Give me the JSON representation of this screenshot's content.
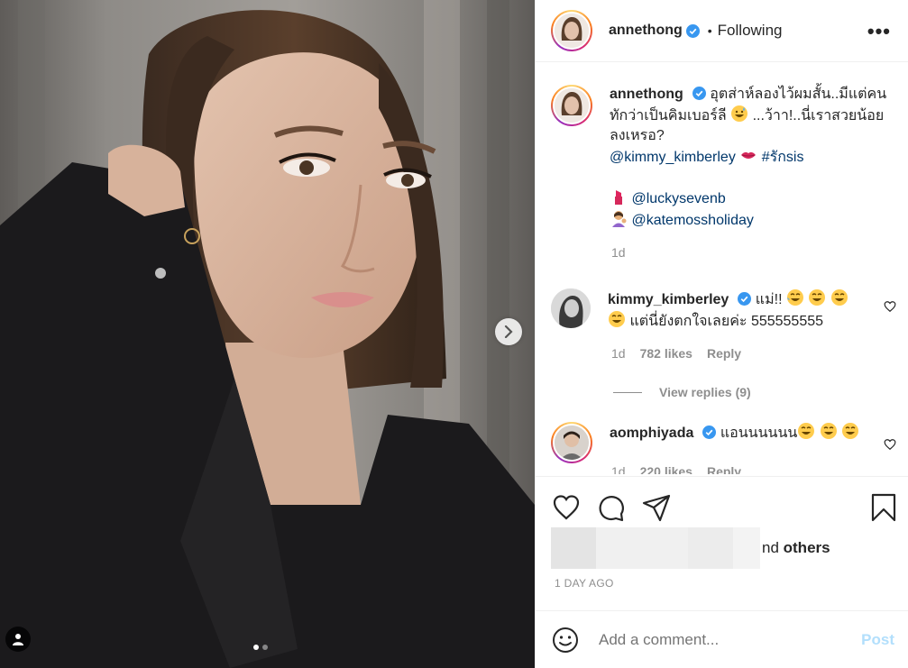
{
  "colors": {
    "link": "#00376b",
    "verified": "#3897f0",
    "muted": "#8e8e8e",
    "post_disabled": "#b2dffc"
  },
  "media": {
    "dots_total": 2,
    "active_dot": 1
  },
  "header": {
    "username": "annethong",
    "separator": "•",
    "following_label": "Following",
    "more_label": "•••"
  },
  "caption": {
    "username": "annethong",
    "line1": "อุตส่าห์ลองไว้ผมสั้น..มีแต่คนทักว่าเป็นคิมเบอร์ลี",
    "line1_after": "...ว้าา!..นี่เราสวยน้อยลงเหรอ?",
    "mention1": "@kimmy_kimberley",
    "hashtag": "#รักsis",
    "mention2": "@luckysevenb",
    "mention3": "@katemossholiday",
    "time": "1d"
  },
  "comments": [
    {
      "username": "kimmy_kimberley",
      "text1": "แม่!!",
      "text2": "แต่นี่ยังตกใจเลยค่ะ 555555555",
      "time": "1d",
      "likes": "782 likes",
      "reply": "Reply"
    },
    {
      "username": "aomphiyada",
      "text1": "แอนนนนนน",
      "time": "1d",
      "likes": "220 likes",
      "reply": "Reply"
    }
  ],
  "view_replies": "View replies (9)",
  "likers": {
    "text_suffix": "nd ",
    "others": "others"
  },
  "date": "1 DAY AGO",
  "add_comment": {
    "placeholder": "Add a comment...",
    "post": "Post"
  },
  "icons": [
    "heart-icon",
    "comment-icon",
    "share-icon",
    "bookmark-icon",
    "smile-icon",
    "chevron-right-icon",
    "user-tag-icon",
    "verified-badge-icon",
    "lipstick-icon",
    "lips-icon",
    "person-tipping-hand-icon",
    "grinning-sweat-icon",
    "tears-of-joy-icon"
  ]
}
